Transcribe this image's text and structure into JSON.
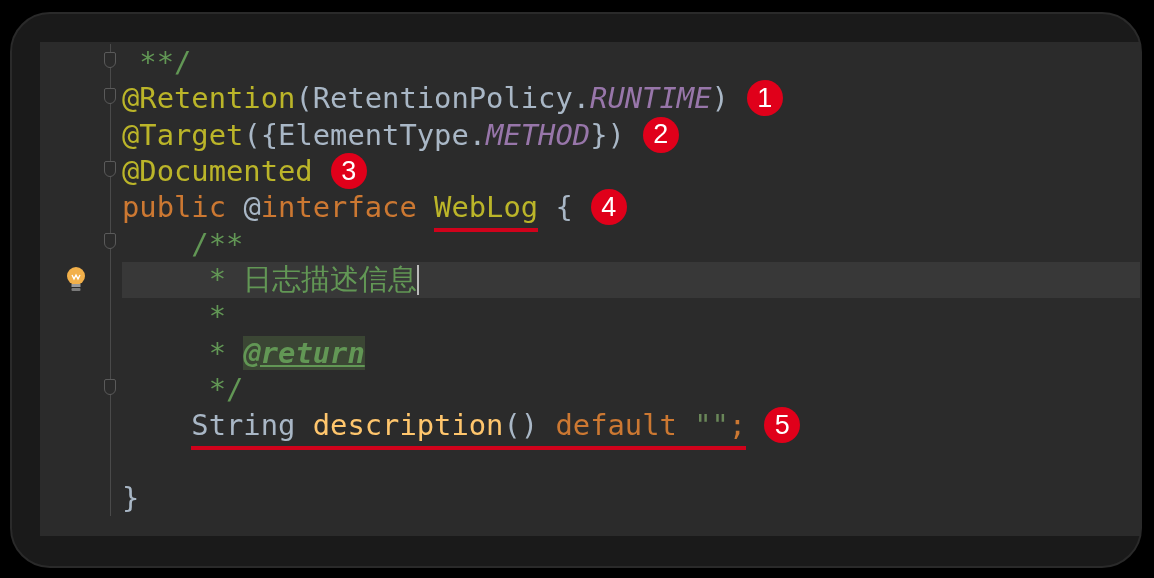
{
  "editor": {
    "lines": [
      {
        "fold": true,
        "current": false,
        "cursor": false,
        "bulb": false,
        "tokens": [
          {
            "kind": "comment",
            "text": " **/",
            "marked": false
          }
        ]
      },
      {
        "fold": true,
        "current": false,
        "cursor": false,
        "bulb": false,
        "badge": "1",
        "tokens": [
          {
            "kind": "annotation",
            "text": "@Retention",
            "marked": false
          },
          {
            "kind": "plain",
            "text": "(RetentionPolicy.",
            "marked": false
          },
          {
            "kind": "constant",
            "text": "RUNTIME",
            "marked": false
          },
          {
            "kind": "plain",
            "text": ")",
            "marked": false
          }
        ]
      },
      {
        "fold": false,
        "current": false,
        "cursor": false,
        "bulb": false,
        "badge": "2",
        "tokens": [
          {
            "kind": "annotation",
            "text": "@Target",
            "marked": false
          },
          {
            "kind": "plain",
            "text": "({ElementType.",
            "marked": false
          },
          {
            "kind": "constant",
            "text": "METHOD",
            "marked": false
          },
          {
            "kind": "plain",
            "text": "})",
            "marked": false
          }
        ]
      },
      {
        "fold": true,
        "current": false,
        "cursor": false,
        "bulb": false,
        "badge": "3",
        "tokens": [
          {
            "kind": "annotation",
            "text": "@Documented",
            "marked": false
          }
        ]
      },
      {
        "fold": false,
        "current": false,
        "cursor": false,
        "bulb": false,
        "badge": "4",
        "tokens": [
          {
            "kind": "keyword",
            "text": "public ",
            "marked": false
          },
          {
            "kind": "plain",
            "text": "@",
            "marked": false
          },
          {
            "kind": "keyword",
            "text": "interface ",
            "marked": false
          },
          {
            "kind": "annotation",
            "text": "WebLog",
            "marked": true
          },
          {
            "kind": "plain",
            "text": " {",
            "marked": false
          }
        ]
      },
      {
        "fold": true,
        "current": false,
        "cursor": false,
        "bulb": false,
        "tokens": [
          {
            "kind": "comment",
            "text": "    /**",
            "marked": false
          }
        ]
      },
      {
        "fold": false,
        "current": true,
        "cursor": true,
        "bulb": true,
        "tokens": [
          {
            "kind": "comment",
            "text": "     * 日志描述信息",
            "marked": false
          }
        ]
      },
      {
        "fold": false,
        "current": false,
        "cursor": false,
        "bulb": false,
        "tokens": [
          {
            "kind": "comment",
            "text": "     *",
            "marked": false
          }
        ]
      },
      {
        "fold": false,
        "current": false,
        "cursor": false,
        "bulb": false,
        "tokens": [
          {
            "kind": "comment",
            "text": "     * ",
            "marked": false
          },
          {
            "kind": "doctag",
            "text": "@return",
            "marked": false
          }
        ]
      },
      {
        "fold": true,
        "current": false,
        "cursor": false,
        "bulb": false,
        "tokens": [
          {
            "kind": "comment",
            "text": "     */",
            "marked": false
          }
        ]
      },
      {
        "fold": false,
        "current": false,
        "cursor": false,
        "bulb": false,
        "badge": "5",
        "tokens": [
          {
            "kind": "plain",
            "text": "    String ",
            "marked": true
          },
          {
            "kind": "method",
            "text": "description",
            "marked": true
          },
          {
            "kind": "plain",
            "text": "() ",
            "marked": true
          },
          {
            "kind": "keyword",
            "text": "default ",
            "marked": true
          },
          {
            "kind": "string",
            "text": "\"\"",
            "marked": true
          },
          {
            "kind": "keyword",
            "text": ";",
            "marked": true
          }
        ]
      },
      {
        "fold": false,
        "current": false,
        "cursor": false,
        "bulb": false
      },
      {
        "fold": false,
        "current": false,
        "cursor": false,
        "bulb": false,
        "tokens": [
          {
            "kind": "plain",
            "text": "}",
            "marked": false
          }
        ]
      }
    ]
  }
}
